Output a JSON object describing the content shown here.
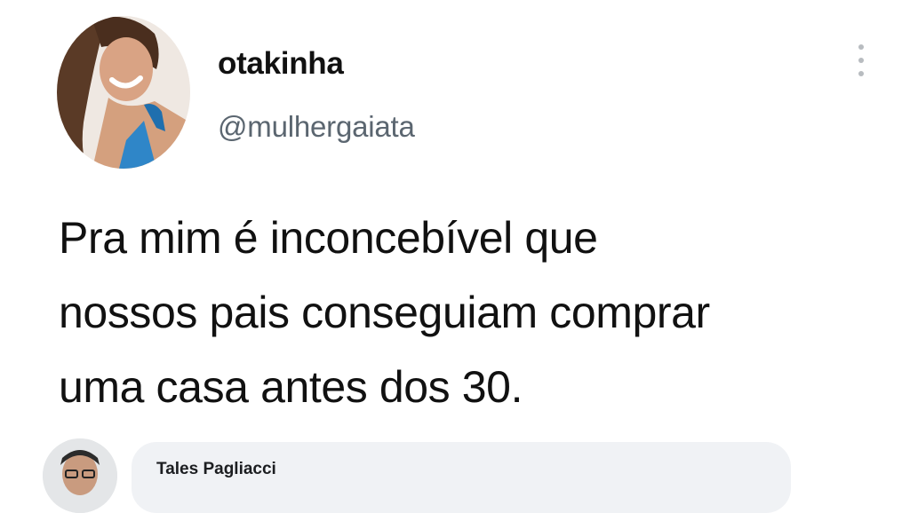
{
  "tweet": {
    "display_name": "otakinha",
    "handle": "@mulhergaiata",
    "text_lines": [
      "Pra mim é inconcebível que",
      "nossos pais conseguiam comprar",
      "uma casa antes dos 30."
    ],
    "more_icon": "more-vertical-icon"
  },
  "reply": {
    "author_name": "Tales Pagliacci"
  }
}
